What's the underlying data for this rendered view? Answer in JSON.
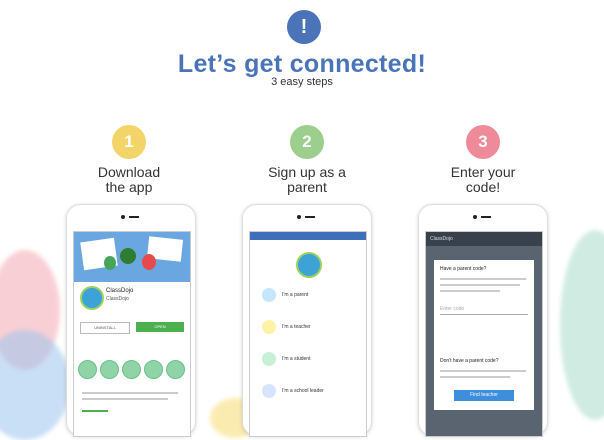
{
  "header": {
    "icon_glyph": "!",
    "title": "Let’s get connected!",
    "subtitle": "3 easy steps"
  },
  "colors": {
    "accent_blue": "#4a73b8",
    "step1": "#f2d469",
    "step2": "#9ccf8d",
    "step3": "#ee8a9a"
  },
  "steps": [
    {
      "number": "1",
      "text": "Download\nthe app"
    },
    {
      "number": "2",
      "text": "Sign up as a\nparent"
    },
    {
      "number": "3",
      "text": "Enter your\ncode!"
    }
  ],
  "phone1": {
    "app_name": "ClassDojo",
    "app_sub": "ClassDojo",
    "btn_left": "UNINSTALL",
    "btn_right": "OPEN"
  },
  "phone2": {
    "roles": [
      "I'm a parent",
      "I'm a teacher",
      "I'm a student",
      "I'm a school leader"
    ]
  },
  "phone3": {
    "topbar": "ClassDojo",
    "heading": "Have a parent code?",
    "input_placeholder": "Enter code",
    "no_code_heading": "Don't have a parent code?",
    "button": "Find teacher"
  }
}
